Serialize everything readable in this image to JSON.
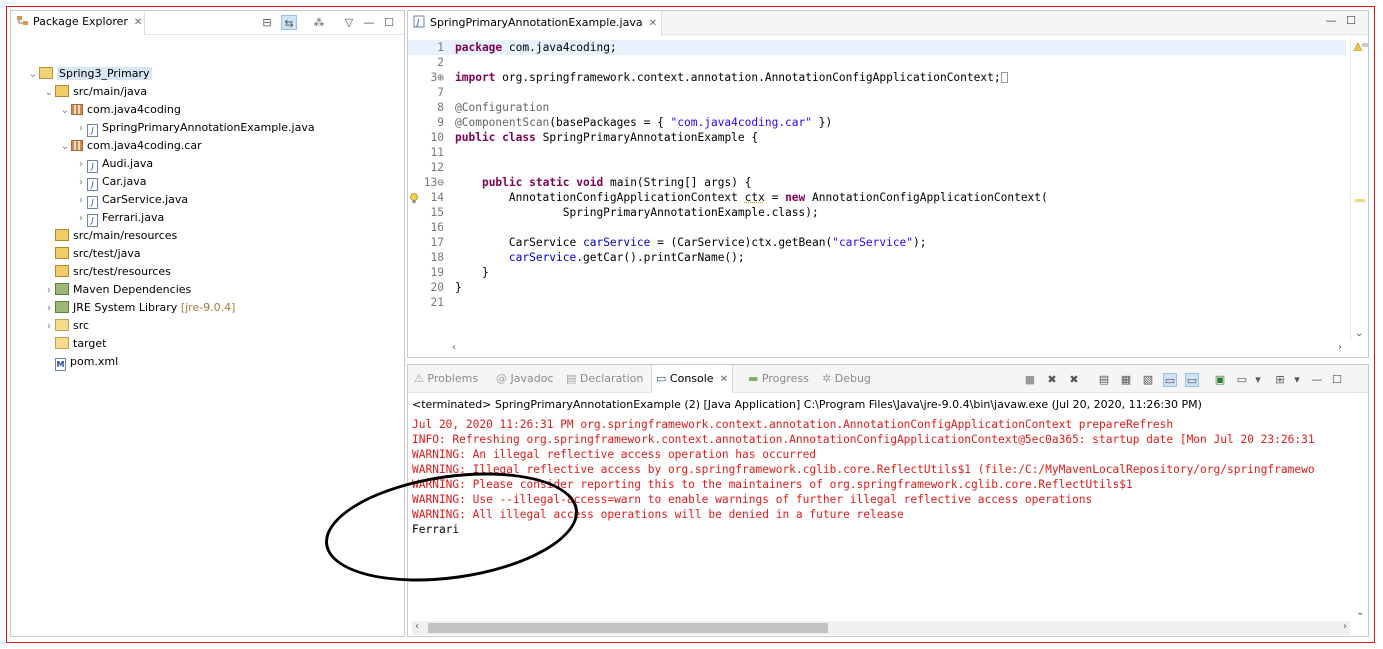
{
  "package_explorer": {
    "tab_label": "Package Explorer",
    "tree": [
      {
        "label": "Spring3_Primary",
        "icon": "project-icon",
        "twisty": "expanded",
        "selected": true
      },
      {
        "label": "src/main/java",
        "icon": "source-folder-icon",
        "twisty": "expanded"
      },
      {
        "label": "com.java4coding",
        "icon": "package-icon",
        "twisty": "expanded"
      },
      {
        "label": "SpringPrimaryAnnotationExample.java",
        "icon": "java-file-icon",
        "twisty": "collapsed"
      },
      {
        "label": "com.java4coding.car",
        "icon": "package-icon",
        "twisty": "expanded"
      },
      {
        "label": "Audi.java",
        "icon": "java-file-icon",
        "twisty": "collapsed"
      },
      {
        "label": "Car.java",
        "icon": "java-interface-file-icon",
        "twisty": "collapsed"
      },
      {
        "label": "CarService.java",
        "icon": "java-file-icon",
        "twisty": "collapsed"
      },
      {
        "label": "Ferrari.java",
        "icon": "java-file-icon",
        "twisty": "collapsed"
      },
      {
        "label": "src/main/resources",
        "icon": "source-folder-icon",
        "twisty": "none"
      },
      {
        "label": "src/test/java",
        "icon": "source-folder-icon",
        "twisty": "none"
      },
      {
        "label": "src/test/resources",
        "icon": "source-folder-icon",
        "twisty": "none"
      },
      {
        "label": "Maven Dependencies",
        "icon": "library-icon",
        "twisty": "collapsed"
      },
      {
        "label": "JRE System Library",
        "suffix": "[jre-9.0.4]",
        "icon": "library-icon",
        "twisty": "collapsed"
      },
      {
        "label": "src",
        "icon": "folder-icon",
        "twisty": "collapsed"
      },
      {
        "label": "target",
        "icon": "folder-icon",
        "twisty": "none"
      },
      {
        "label": "pom.xml",
        "icon": "xml-file-icon",
        "twisty": "none"
      }
    ]
  },
  "editor": {
    "tab_label": "SpringPrimaryAnnotationExample.java",
    "lines": [
      {
        "no": "1",
        "text": "package com.java4coding;"
      },
      {
        "no": "2",
        "text": ""
      },
      {
        "no": "3⊕",
        "text": "import org.springframework.context.annotation.AnnotationConfigApplicationContext;▯"
      },
      {
        "no": "7",
        "text": ""
      },
      {
        "no": "8",
        "text": "@Configuration"
      },
      {
        "no": "9",
        "text": "@ComponentScan(basePackages = { \"com.java4coding.car\" })"
      },
      {
        "no": "10",
        "text": "public class SpringPrimaryAnnotationExample {"
      },
      {
        "no": "11",
        "text": ""
      },
      {
        "no": "12",
        "text": ""
      },
      {
        "no": "13⊖",
        "text": "    public static void main(String[] args) {"
      },
      {
        "no": "14",
        "text": "        AnnotationConfigApplicationContext ctx = new AnnotationConfigApplicationContext("
      },
      {
        "no": "15",
        "text": "                SpringPrimaryAnnotationExample.class);"
      },
      {
        "no": "16",
        "text": ""
      },
      {
        "no": "17",
        "text": "        CarService carService = (CarService)ctx.getBean(\"carService\");"
      },
      {
        "no": "18",
        "text": "        carService.getCar().printCarName();"
      },
      {
        "no": "19",
        "text": "    }"
      },
      {
        "no": "20",
        "text": "}"
      },
      {
        "no": "21",
        "text": ""
      }
    ]
  },
  "bottom_tabs": [
    {
      "label": "Problems",
      "icon": "problems-icon",
      "active": false
    },
    {
      "label": "Javadoc",
      "icon": "javadoc-icon",
      "active": false
    },
    {
      "label": "Declaration",
      "icon": "declaration-icon",
      "active": false
    },
    {
      "label": "Console",
      "icon": "console-icon",
      "active": true
    },
    {
      "label": "Progress",
      "icon": "progress-icon",
      "active": false
    },
    {
      "label": "Debug",
      "icon": "debug-icon",
      "active": false
    }
  ],
  "console": {
    "terminated_line": "<terminated> SpringPrimaryAnnotationExample (2) [Java Application] C:\\Program Files\\Java\\jre-9.0.4\\bin\\javaw.exe (Jul 20, 2020, 11:26:30 PM)",
    "lines": [
      {
        "text": "Jul 20, 2020 11:26:31 PM org.springframework.context.annotation.AnnotationConfigApplicationContext prepareRefresh",
        "stream": "err"
      },
      {
        "text": "INFO: Refreshing org.springframework.context.annotation.AnnotationConfigApplicationContext@5ec0a365: startup date [Mon Jul 20 23:26:31",
        "stream": "err"
      },
      {
        "text": "WARNING: An illegal reflective access operation has occurred",
        "stream": "err"
      },
      {
        "text": "WARNING: Illegal reflective access by org.springframework.cglib.core.ReflectUtils$1 (file:/C:/MyMavenLocalRepository/org/springframewo",
        "stream": "err"
      },
      {
        "text": "WARNING: Please consider reporting this to the maintainers of org.springframework.cglib.core.ReflectUtils$1",
        "stream": "err"
      },
      {
        "text": "WARNING: Use --illegal-access=warn to enable warnings of further illegal reflective access operations",
        "stream": "err"
      },
      {
        "text": "WARNING: All illegal access operations will be denied in a future release",
        "stream": "err"
      },
      {
        "text": "Ferrari",
        "stream": "out"
      }
    ]
  },
  "colors": {
    "frame_border": "#d91a1a",
    "keyword": "#7f0055",
    "string": "#2a00ff",
    "annotation": "#646464",
    "field": "#0000c0",
    "stderr": "#e01b1b",
    "selection": "#d8e6f7"
  }
}
